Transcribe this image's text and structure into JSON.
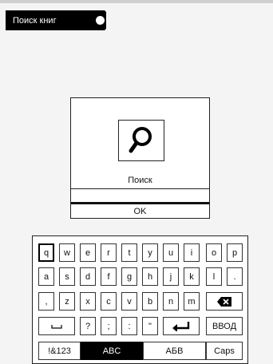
{
  "header": {
    "title": "Поиск книг"
  },
  "dialog": {
    "label": "Поиск",
    "ok_label": "OK"
  },
  "keyboard": {
    "row1": [
      "q",
      "w",
      "e",
      "r",
      "t",
      "y",
      "u",
      "i",
      "o",
      "p"
    ],
    "row2": [
      "a",
      "s",
      "d",
      "f",
      "g",
      "h",
      "j",
      "k",
      "l",
      "."
    ],
    "row3": [
      ",",
      "z",
      "x",
      "c",
      "v",
      "b",
      "n",
      "m"
    ],
    "row4": [
      "?",
      ";",
      ":",
      "\""
    ],
    "enter_label": "ВВОД",
    "symbols_label": "!&123",
    "abc_label": "ABC",
    "cyrillic_label": "АБВ",
    "caps_label": "Caps"
  }
}
